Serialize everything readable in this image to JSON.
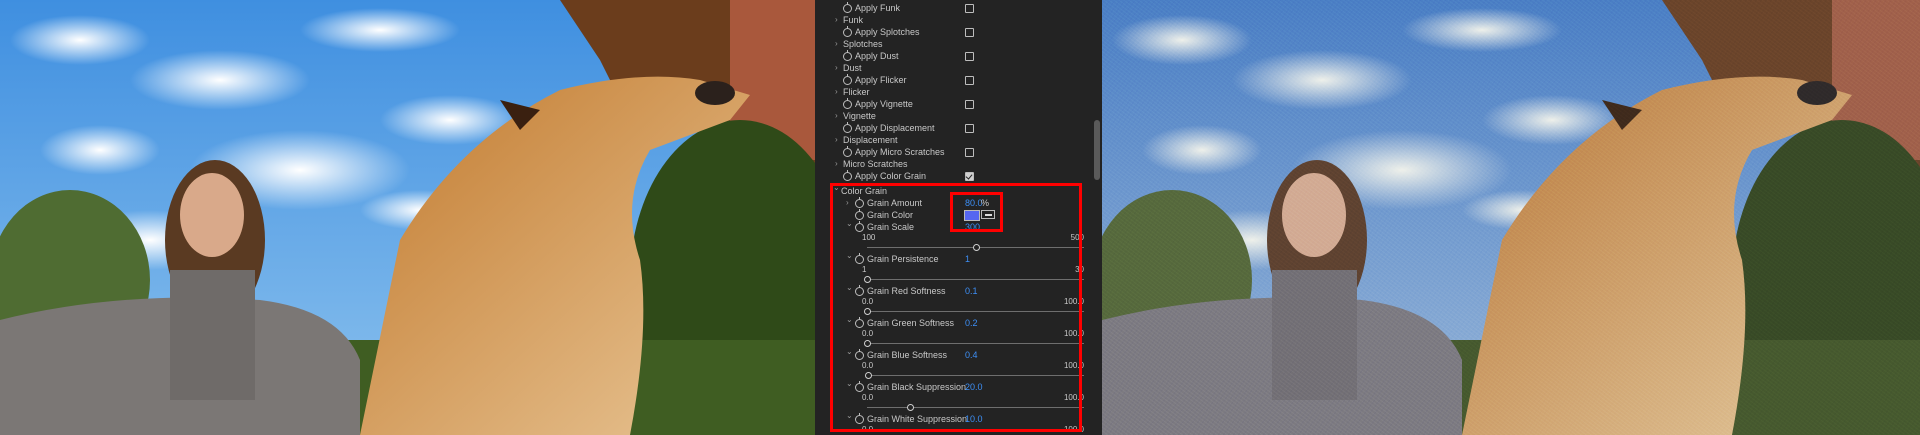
{
  "colors": {
    "panel_bg": "#232323",
    "value_blue": "#3d8ff6",
    "highlight_red": "#ff0000",
    "grain_color_swatch": "#5566f0"
  },
  "effects": [
    {
      "checkbox_label": "Apply Funk",
      "checked": false
    },
    {
      "section": "Funk",
      "checkbox_label": "Apply Splotches",
      "checked": false
    },
    {
      "section": "Splotches",
      "checkbox_label": "Apply Dust",
      "checked": false
    },
    {
      "section": "Dust",
      "checkbox_label": "Apply Flicker",
      "checked": false
    },
    {
      "section": "Flicker",
      "checkbox_label": "Apply Vignette",
      "checked": false
    },
    {
      "section": "Vignette",
      "checkbox_label": "Apply Displacement",
      "checked": false
    },
    {
      "section": "Displacement",
      "checkbox_label": "Apply Micro Scratches",
      "checked": false
    },
    {
      "section": "Micro Scratches",
      "checkbox_label": "Apply Color Grain",
      "checked": true
    }
  ],
  "color_grain": {
    "section": "Color Grain",
    "grain_amount": {
      "label": "Grain Amount",
      "value": "80.0",
      "unit": "%"
    },
    "grain_color": {
      "label": "Grain Color"
    },
    "grain_scale": {
      "label": "Grain Scale",
      "value": "300",
      "min": "100",
      "max": "500",
      "fraction": 0.5
    },
    "params": [
      {
        "label": "Grain Persistence",
        "value": "1",
        "min": "1",
        "max": "30",
        "fraction": 0.0
      },
      {
        "label": "Grain Red Softness",
        "value": "0.1",
        "min": "0.0",
        "max": "100.0",
        "fraction": 0.001
      },
      {
        "label": "Grain Green Softness",
        "value": "0.2",
        "min": "0.0",
        "max": "100.0",
        "fraction": 0.002
      },
      {
        "label": "Grain Blue Softness",
        "value": "0.4",
        "min": "0.0",
        "max": "100.0",
        "fraction": 0.004
      },
      {
        "label": "Grain Black Suppression",
        "value": "20.0",
        "min": "0.0",
        "max": "100.0",
        "fraction": 0.2
      },
      {
        "label": "Grain White Suppression",
        "value": "10.0",
        "min": "0.0",
        "max": "100.0",
        "fraction": 0.1
      }
    ]
  }
}
